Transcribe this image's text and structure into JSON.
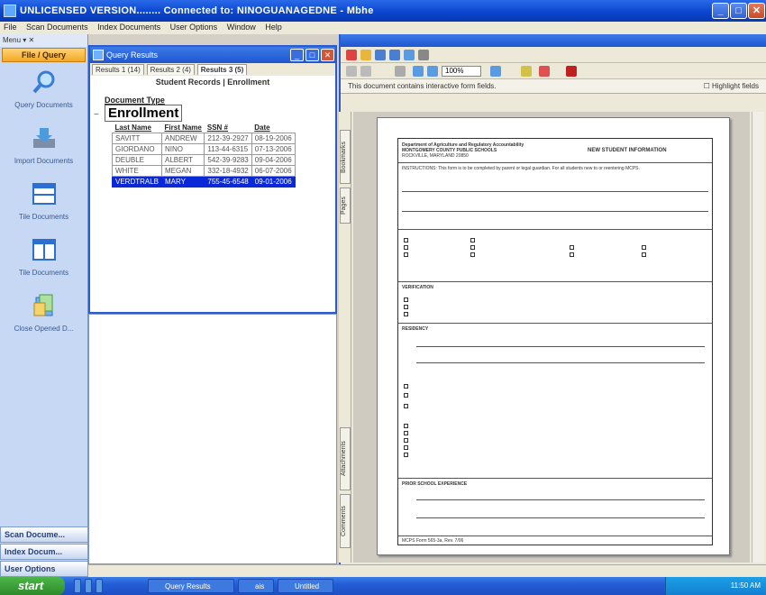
{
  "window": {
    "title": "UNLICENSED VERSION........ Connected to: NINOGUANAGEDNE - Mbhe"
  },
  "menubar": [
    "File",
    "Scan Documents",
    "Index Documents",
    "User Options",
    "Window",
    "Help"
  ],
  "leftnav": {
    "menu_label": "Menu",
    "section_title": "File / Query",
    "items": [
      {
        "label": "Query Documents",
        "icon": "magnifier-icon"
      },
      {
        "label": "Import Documents",
        "icon": "import-icon"
      },
      {
        "label": "Tile Documents",
        "icon": "tile-horizontal-icon"
      },
      {
        "label": "Tile Documents",
        "icon": "tile-vertical-icon"
      },
      {
        "label": "Close Opened D...",
        "icon": "close-docs-icon"
      }
    ],
    "bottom_buttons": [
      "Scan Docume...",
      "Index Docum...",
      "User Options"
    ]
  },
  "query_window": {
    "title": "Query Results",
    "tabs": [
      "Results 1 (14)",
      "Results 2 (4)",
      "Results 3 (5)"
    ],
    "active_tab": 2,
    "header": "Student Records  |  Enrollment",
    "document_type_label": "Document Type",
    "document_type": "Enrollment",
    "columns": [
      "Last Name",
      "First Name",
      "SSN #",
      "Date"
    ],
    "rows": [
      [
        "SAVITT",
        "ANDREW",
        "212-39-2927",
        "08-19-2006"
      ],
      [
        "GIORDANO",
        "NINO",
        "113-44-6315",
        "07-13-2006"
      ],
      [
        "DEUBLE",
        "ALBERT",
        "542-39-9283",
        "09-04-2006"
      ],
      [
        "WHITE",
        "MEGAN",
        "332-18-4932",
        "06-07-2006"
      ],
      [
        "VERDTRALB",
        "MARY",
        "755-45-6548",
        "09-01-2006"
      ]
    ],
    "selected_row": 4
  },
  "viewer": {
    "zoom": "100%",
    "info_text": "This document contains interactive form fields.",
    "highlight_label": "Highlight fields",
    "side_tabs": [
      "Bookmarks",
      "Pages",
      "Attachments",
      "Comments"
    ],
    "form": {
      "header_left": "Department of Agriculture and Regulatory Accountability",
      "header_left2": "MONTGOMERY COUNTY PUBLIC SCHOOLS",
      "header_left3": "ROCKVILLE, MARYLAND 20850",
      "header_right": "NEW STUDENT INFORMATION",
      "instructions": "INSTRUCTIONS: This form is to be completed by parent or legal guardian. For all students new to or reentering MCPS.",
      "section_verification": "VERIFICATION",
      "section_residency": "RESIDENCY",
      "section_prior_school": "PRIOR SCHOOL EXPERIENCE",
      "footer": "MCPS Form 565-3a, Rev. 7/06"
    }
  },
  "taskbar": {
    "start_label": "start",
    "items": [
      "Query Results",
      "ais",
      "Untitled"
    ],
    "clock": "11:50 AM"
  }
}
